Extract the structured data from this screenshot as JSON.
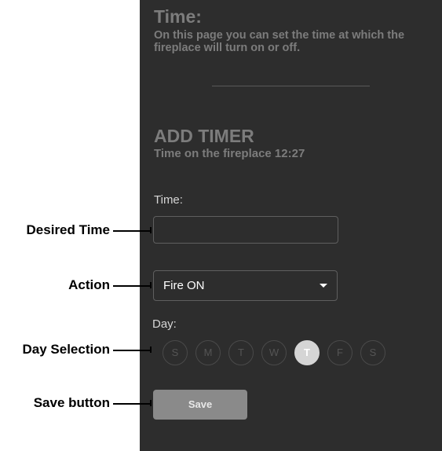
{
  "header": {
    "title": "Time:",
    "description": "On this page you can set the time at which the fireplace will turn on or off."
  },
  "add_timer": {
    "title": "ADD TIMER",
    "subtitle": "Time on the fireplace 12:27"
  },
  "form": {
    "time_label": "Time:",
    "time_value": "",
    "action_value": "Fire ON",
    "day_label": "Day:",
    "days": [
      "S",
      "M",
      "T",
      "W",
      "T",
      "F",
      "S"
    ],
    "selected_day_index": 4,
    "save_label": "Save"
  },
  "callouts": {
    "desired_time": "Desired Time",
    "action": "Action",
    "day_selection": "Day Selection",
    "save_button": "Save button"
  },
  "colors": {
    "panel_bg": "#2d2d2d",
    "heading_text": "#7c7c7c",
    "selected_day": "#d5d5d5",
    "save_button_bg": "#8a8a8a"
  }
}
